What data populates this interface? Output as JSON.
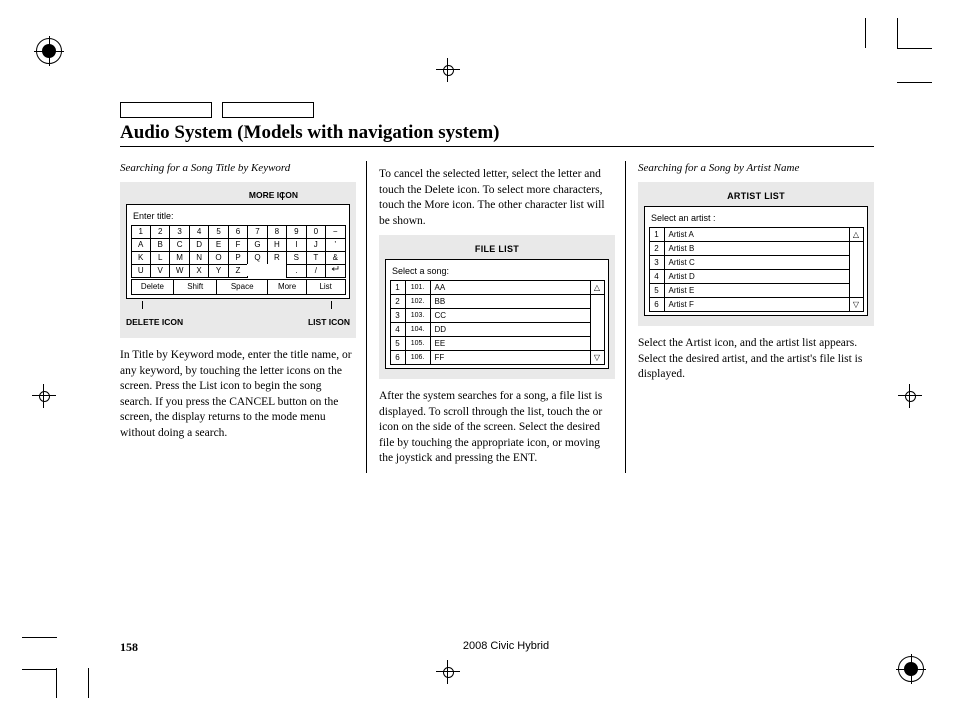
{
  "page": {
    "title": "Audio System (Models with navigation system)",
    "number": "158",
    "vehicle": "2008  Civic  Hybrid"
  },
  "col1": {
    "subhead": "Searching for a Song Title by Keyword",
    "callout_more": "MORE ICON",
    "callout_delete": "DELETE ICON",
    "callout_list": "LIST ICON",
    "keyboard": {
      "prompt": "Enter title:",
      "rows": [
        [
          "1",
          "2",
          "3",
          "4",
          "5",
          "6",
          "7",
          "8",
          "9",
          "0",
          "−"
        ],
        [
          "A",
          "B",
          "C",
          "D",
          "E",
          "F",
          "G",
          "H",
          "I",
          "J",
          "'"
        ],
        [
          "K",
          "L",
          "M",
          "N",
          "O",
          "P",
          "Q",
          "R",
          "S",
          "T",
          "&"
        ],
        [
          "U",
          "V",
          "W",
          "X",
          "Y",
          "Z",
          "",
          "",
          ".",
          "/",
          "↵"
        ]
      ],
      "fn": [
        "Delete",
        "Shift",
        "Space",
        "More",
        "List"
      ]
    },
    "body": "In Title by Keyword mode, enter the title name, or any keyword, by touching the letter icons on the screen. Press the List icon to begin the song search. If you press the CANCEL button on the screen, the display returns to the mode menu without doing a search."
  },
  "col2": {
    "para1": "To cancel the selected letter, select the letter and touch the Delete icon. To select more characters, touch the More icon. The other character list will be shown.",
    "file_list": {
      "title": "FILE LIST",
      "prompt": "Select a song:",
      "items": [
        {
          "idx": "1",
          "num": "101.",
          "name": "AA"
        },
        {
          "idx": "2",
          "num": "102.",
          "name": "BB"
        },
        {
          "idx": "3",
          "num": "103.",
          "name": "CC"
        },
        {
          "idx": "4",
          "num": "104.",
          "name": "DD"
        },
        {
          "idx": "5",
          "num": "105.",
          "name": "EE"
        },
        {
          "idx": "6",
          "num": "106.",
          "name": "FF"
        }
      ]
    },
    "para2": "After the system searches for a song, a file list is displayed. To scroll through the list, touch the      or      icon on the side of the screen. Select the desired file by touching the appropriate icon, or moving the joystick and pressing the ENT."
  },
  "col3": {
    "subhead": "Searching for a Song by Artist Name",
    "artist_list": {
      "title": "ARTIST LIST",
      "prompt": "Select an artist :",
      "items": [
        {
          "idx": "1",
          "name": "Artist  A"
        },
        {
          "idx": "2",
          "name": "Artist  B"
        },
        {
          "idx": "3",
          "name": "Artist  C"
        },
        {
          "idx": "4",
          "name": "Artist  D"
        },
        {
          "idx": "5",
          "name": "Artist  E"
        },
        {
          "idx": "6",
          "name": "Artist  F"
        }
      ]
    },
    "body": "Select the Artist icon, and the artist list appears. Select the desired artist, and the artist's file list is displayed."
  }
}
